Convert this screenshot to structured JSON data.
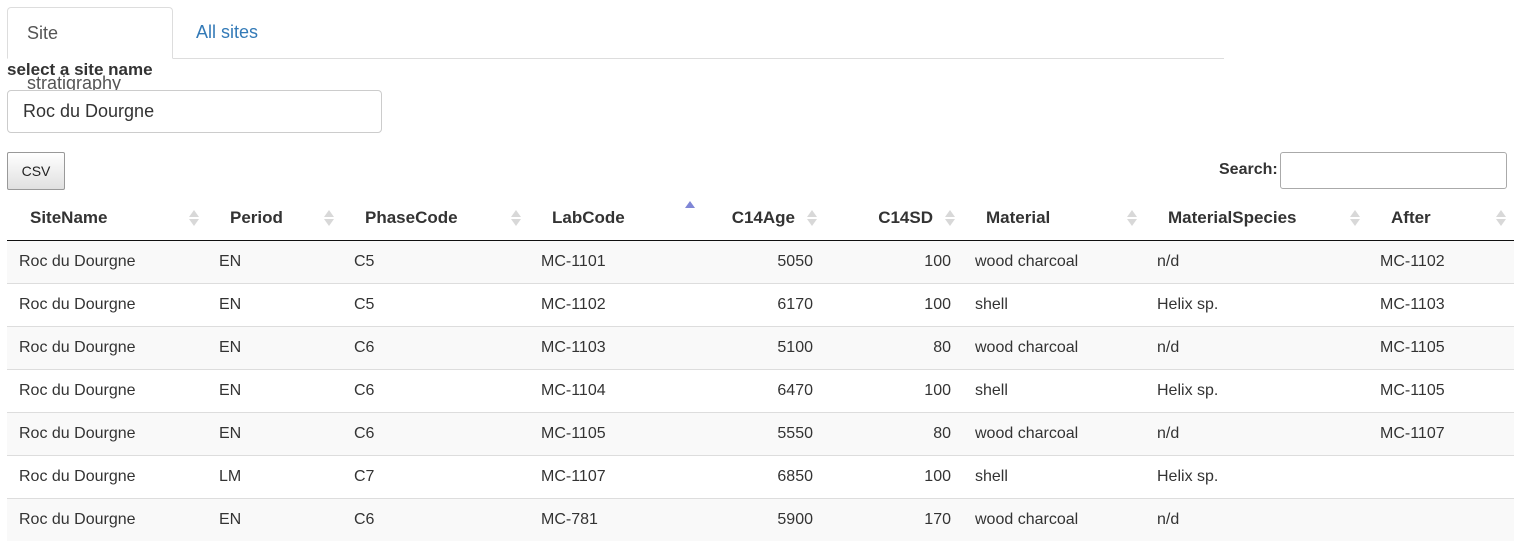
{
  "tabs": [
    {
      "label": "Site stratigraphy",
      "active": true
    },
    {
      "label": "All sites",
      "active": false
    }
  ],
  "site_select": {
    "label": "select a site name",
    "value": "Roc du Dourgne"
  },
  "toolbar": {
    "csv_label": "CSV",
    "search_label": "Search:",
    "search_value": ""
  },
  "table": {
    "columns": [
      "SiteName",
      "Period",
      "PhaseCode",
      "LabCode",
      "C14Age",
      "C14SD",
      "Material",
      "MaterialSpecies",
      "After"
    ],
    "sorted_column": "LabCode",
    "sort_direction": "asc",
    "rows": [
      [
        "Roc du Dourgne",
        "EN",
        "C5",
        "MC-1101",
        "5050",
        "100",
        "wood charcoal",
        "n/d",
        "MC-1102"
      ],
      [
        "Roc du Dourgne",
        "EN",
        "C5",
        "MC-1102",
        "6170",
        "100",
        "shell",
        "Helix sp.",
        "MC-1103"
      ],
      [
        "Roc du Dourgne",
        "EN",
        "C6",
        "MC-1103",
        "5100",
        "80",
        "wood charcoal",
        "n/d",
        "MC-1105"
      ],
      [
        "Roc du Dourgne",
        "EN",
        "C6",
        "MC-1104",
        "6470",
        "100",
        "shell",
        "Helix sp.",
        "MC-1105"
      ],
      [
        "Roc du Dourgne",
        "EN",
        "C6",
        "MC-1105",
        "5550",
        "80",
        "wood charcoal",
        "n/d",
        "MC-1107"
      ],
      [
        "Roc du Dourgne",
        "LM",
        "C7",
        "MC-1107",
        "6850",
        "100",
        "shell",
        "Helix sp.",
        ""
      ],
      [
        "Roc du Dourgne",
        "EN",
        "C6",
        "MC-781",
        "5900",
        "170",
        "wood charcoal",
        "n/d",
        ""
      ]
    ]
  },
  "colors": {
    "link": "#337ab7",
    "sort_active": "#7f86d6",
    "stripe": "#f9f9f9"
  }
}
